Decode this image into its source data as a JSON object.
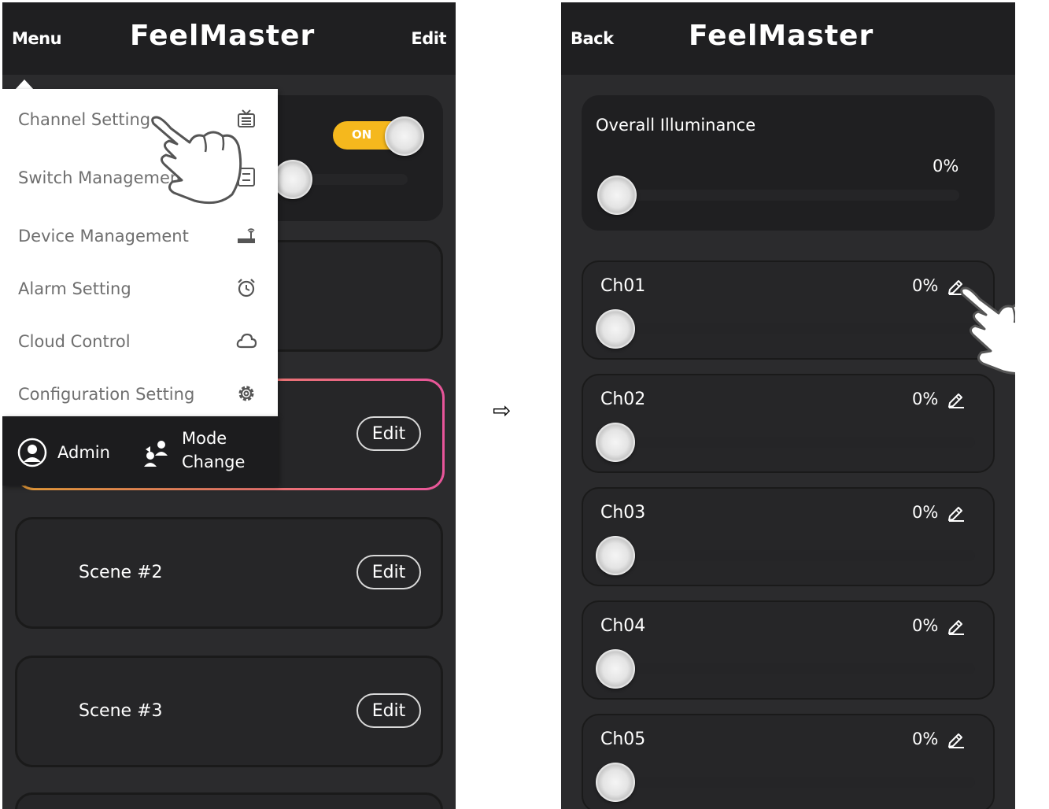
{
  "left_screen": {
    "header": {
      "menu_label": "Menu",
      "title": "FeelMaster",
      "edit_label": "Edit"
    },
    "toggle": {
      "label": "ON",
      "state": "on"
    },
    "menu": {
      "items": [
        {
          "label": "Channel Setting",
          "icon": "tv-icon"
        },
        {
          "label": "Switch Management",
          "icon": "switch-panel-icon"
        },
        {
          "label": "Device Management",
          "icon": "router-icon"
        },
        {
          "label": "Alarm Setting",
          "icon": "alarm-clock-icon"
        },
        {
          "label": "Cloud Control",
          "icon": "cloud-icon"
        },
        {
          "label": "Configuration Setting",
          "icon": "gear-icon"
        }
      ],
      "footer": {
        "admin_label": "Admin",
        "mode_line1": "Mode",
        "mode_line2": "Change"
      }
    },
    "scenes": [
      {
        "name": "",
        "edit_label": "Edit"
      },
      {
        "name": "Scene #2",
        "edit_label": "Edit"
      },
      {
        "name": "Scene #3",
        "edit_label": "Edit"
      }
    ]
  },
  "arrow": "⇨",
  "right_screen": {
    "header": {
      "back_label": "Back",
      "title": "FeelMaster"
    },
    "overall": {
      "label": "Overall Illuminance",
      "value": "0%",
      "level": 0
    },
    "channels": [
      {
        "label": "Ch01",
        "value": "0%",
        "level": 0
      },
      {
        "label": "Ch02",
        "value": "0%",
        "level": 0
      },
      {
        "label": "Ch03",
        "value": "0%",
        "level": 0
      },
      {
        "label": "Ch04",
        "value": "0%",
        "level": 0
      },
      {
        "label": "Ch05",
        "value": "0%",
        "level": 0
      }
    ]
  },
  "colors": {
    "background": "#2b2b2d",
    "header": "#1f1f21",
    "toggle_on": "#f5b81d",
    "highlight_border": "#e8559a"
  }
}
